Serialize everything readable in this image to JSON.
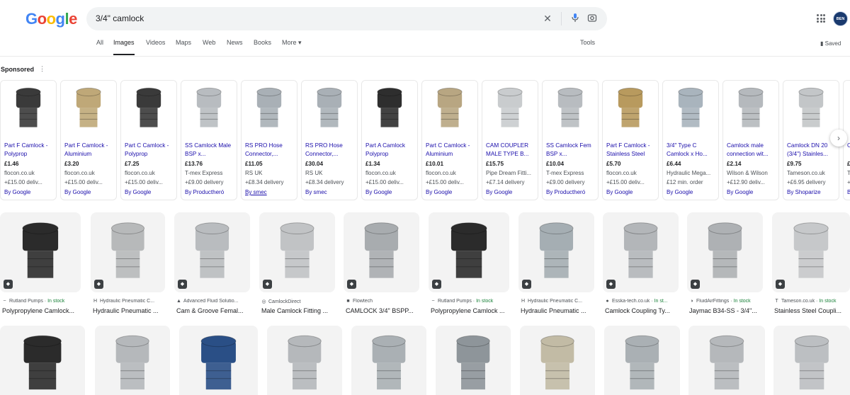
{
  "header": {
    "logo_text": "Google",
    "query": "3/4\" camlock",
    "tabs": [
      "All",
      "Images",
      "Videos",
      "Maps",
      "Web",
      "News",
      "Books",
      "More"
    ],
    "active_tab": "Images",
    "tools": "Tools",
    "saved": "Saved",
    "avatar_text": "BEN CBRC"
  },
  "sponsored": {
    "label": "Sponsored",
    "ads": [
      {
        "title": "Part F Camlock - Polyprop",
        "price": "£1.46",
        "merchant": "flocon.co.uk",
        "shipping": "+£15.00 deliv...",
        "by": "By Google",
        "color": "#3a3a3a"
      },
      {
        "title": "Part F Camlock - Aluminium",
        "price": "£3.20",
        "merchant": "flocon.co.uk",
        "shipping": "+£15.00 deliv...",
        "by": "By Google",
        "color": "#bfa878"
      },
      {
        "title": "Part C Camlock - Polyprop",
        "price": "£7.25",
        "merchant": "flocon.co.uk",
        "shipping": "+£15.00 deliv...",
        "by": "By Google",
        "color": "#3a3a3a"
      },
      {
        "title": "SS Camlock Male BSP x...",
        "price": "£13.76",
        "merchant": "T-mex Express",
        "shipping": "+£9.00 delivery",
        "by": "By Productheró",
        "color": "#b8bcc0"
      },
      {
        "title": "RS PRO Hose Connector,...",
        "price": "£11.05",
        "merchant": "RS UK",
        "shipping": "+£8.34 delivery",
        "by": "By smec",
        "color": "#a9b0b6"
      },
      {
        "title": "RS PRO Hose Connector,...",
        "price": "£30.04",
        "merchant": "RS UK",
        "shipping": "+£8.34 delivery",
        "by": "By smec",
        "color": "#a9b0b6"
      },
      {
        "title": "Part A Camlock Polyprop",
        "price": "£1.34",
        "merchant": "flocon.co.uk",
        "shipping": "+£15.00 deliv...",
        "by": "By Google",
        "color": "#2e2e2e"
      },
      {
        "title": "Part C Camlock -Aluminium",
        "price": "£10.01",
        "merchant": "flocon.co.uk",
        "shipping": "+£15.00 deliv...",
        "by": "By Google",
        "color": "#b8a682"
      },
      {
        "title": "CAM COUPLER MALE TYPE B...",
        "price": "£15.75",
        "merchant": "Pipe Dream Fitti...",
        "shipping": "+£7.14 delivery",
        "by": "By Google",
        "color": "#c9ccce"
      },
      {
        "title": "SS Camlock Fem BSP x...",
        "price": "£10.04",
        "merchant": "T-mex Express",
        "shipping": "+£9.00 delivery",
        "by": "By Productheró",
        "color": "#b8bcc0"
      },
      {
        "title": "Part F Camlock - Stainless Steel",
        "price": "£5.70",
        "merchant": "flocon.co.uk",
        "shipping": "+£15.00 deliv...",
        "by": "By Google",
        "color": "#b89a5e"
      },
      {
        "title": "3/4\" Type C Camlock x Ho...",
        "price": "£6.44",
        "merchant": "Hydraulic Mega...",
        "shipping": "£12 min. order",
        "by": "By Google",
        "color": "#a9b4bd"
      },
      {
        "title": "Camlock male connection wit...",
        "price": "£2.14",
        "merchant": "Wilson & Wilson",
        "shipping": "+£12.90 deliv...",
        "by": "By Google",
        "color": "#b5b9bd"
      },
      {
        "title": "Camlock DN 20 (3/4\") Stainles...",
        "price": "£9.75",
        "merchant": "Tameson.co.uk",
        "shipping": "+£6.95 delivery",
        "by": "By Shoparize",
        "color": "#c3c6c8"
      },
      {
        "title": "C",
        "price": "£",
        "merchant": "T",
        "shipping": "+",
        "by": "B",
        "color": "#c3c6c8"
      }
    ]
  },
  "results_row1": [
    {
      "source": "Rutland Pumps",
      "stock": "In stock",
      "title": "Polypropylene Camlock...",
      "color": "#2b2b2b",
      "fav": "~"
    },
    {
      "source": "Hydraulic Pneumatic C...",
      "stock": "",
      "title": "Hydraulic Pneumatic ...",
      "color": "#b7b9ba",
      "fav": "H"
    },
    {
      "source": "Advanced Fluid Solutio...",
      "stock": "",
      "title": "Cam & Groove Femal...",
      "color": "#b9bcbf",
      "fav": "▲"
    },
    {
      "source": "CamlockDirect",
      "stock": "",
      "title": "Male Camlock Fitting ...",
      "color": "#c1c3c5",
      "fav": "◎"
    },
    {
      "source": "Flowtech",
      "stock": "",
      "title": "CAMLOCK 3/4\" BSPP...",
      "color": "#a8acaf",
      "fav": "■"
    },
    {
      "source": "Rutland Pumps",
      "stock": "In stock",
      "title": "Polypropylene Camlock ...",
      "color": "#2b2b2b",
      "fav": "~"
    },
    {
      "source": "Hydraulic Pneumatic C...",
      "stock": "",
      "title": "Hydraulic Pneumatic ...",
      "color": "#a5aeb3",
      "fav": "H"
    },
    {
      "source": "Esska-tech.co.uk",
      "stock": "In st...",
      "title": "Camlock Coupling Ty...",
      "color": "#b3b6b9",
      "fav": "●"
    },
    {
      "source": "FluidAirFittings",
      "stock": "In stock",
      "title": "Jaymac B34-SS - 3/4\"...",
      "color": "#aeb1b4",
      "fav": "◑"
    },
    {
      "source": "Tameson.co.uk",
      "stock": "In stock",
      "title": "Stainless Steel Coupli...",
      "color": "#c6c8ca",
      "fav": "T"
    }
  ],
  "results_row2": [
    {
      "color": "#2b2b2b"
    },
    {
      "color": "#b5b8bb"
    },
    {
      "color": "#2a4f86"
    },
    {
      "color": "#b5b8bb"
    },
    {
      "color": "#aab0b4"
    },
    {
      "color": "#8e959a"
    },
    {
      "color": "#c2bba5"
    },
    {
      "color": "#aab0b4"
    },
    {
      "color": "#b5b8bb"
    },
    {
      "color": "#bcbfc2"
    }
  ]
}
